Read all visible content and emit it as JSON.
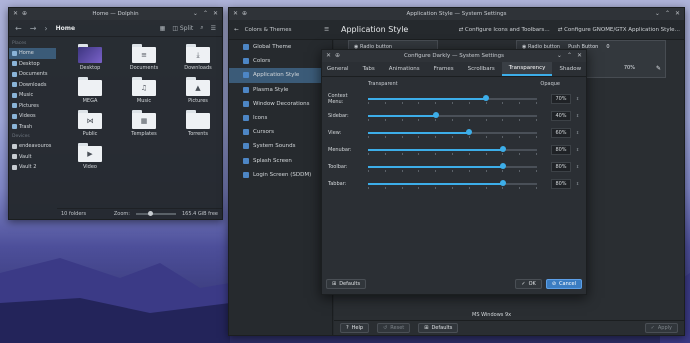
{
  "dolphin": {
    "title": "Home — Dolphin",
    "breadcrumb": "Home",
    "split_label": "Split",
    "places_header": "Places",
    "places": [
      "Home",
      "Desktop",
      "Documents",
      "Downloads",
      "Music",
      "Pictures",
      "Videos",
      "Trash"
    ],
    "devices_header": "Devices",
    "devices": [
      "endeavouros",
      "Vault",
      "Vault 2"
    ],
    "folders": [
      {
        "name": "Desktop",
        "glyph": ""
      },
      {
        "name": "Documents",
        "glyph": "≡"
      },
      {
        "name": "Downloads",
        "glyph": "⤓"
      },
      {
        "name": "MEGA",
        "glyph": ""
      },
      {
        "name": "Music",
        "glyph": "♫"
      },
      {
        "name": "Pictures",
        "glyph": "▲"
      },
      {
        "name": "Public",
        "glyph": "⋈"
      },
      {
        "name": "Templates",
        "glyph": "▦"
      },
      {
        "name": "Torrents",
        "glyph": ""
      },
      {
        "name": "Video",
        "glyph": "▶"
      }
    ],
    "status_count": "10 folders",
    "zoom_label": "Zoom:",
    "free_space": "165.4 GiB free"
  },
  "settings": {
    "title": "Application Style — System Settings",
    "back_label": "Colors & Themes",
    "page_title": "Application Style",
    "header_actions": [
      "Configure Icons and Toolbars…",
      "Configure GNOME/GTX Application Style…"
    ],
    "sidebar": [
      "Global Theme",
      "Colors",
      "Application Style",
      "Plasma Style",
      "Window Decorations",
      "Icons",
      "Cursors",
      "System Sounds",
      "Splash Screen",
      "Login Screen (SDDM)"
    ],
    "selected_index": 2,
    "preview_radio": "Radio button",
    "preview_push": "Push Button",
    "preview_value": "0",
    "preview_pct": "70%",
    "style_name": "MS Windows 9x",
    "footer": {
      "help": "Help",
      "reset": "Reset",
      "defaults": "Defaults",
      "apply": "Apply"
    }
  },
  "dialog": {
    "title": "Configure Darkly — System Settings",
    "tabs": [
      "General",
      "Tabs",
      "Animations",
      "Frames",
      "Scrollbars",
      "Transparency",
      "Shadow"
    ],
    "active_tab": 5,
    "scale_left": "Transparent",
    "scale_right": "Opaque",
    "sliders": [
      {
        "label": "Context Menu:",
        "value": 70,
        "display": "70%"
      },
      {
        "label": "Sidebar:",
        "value": 40,
        "display": "40%"
      },
      {
        "label": "View:",
        "value": 60,
        "display": "60%"
      },
      {
        "label": "Menubar:",
        "value": 80,
        "display": "80%"
      },
      {
        "label": "Toolbar:",
        "value": 80,
        "display": "80%"
      },
      {
        "label": "Tabbar:",
        "value": 80,
        "display": "80%"
      }
    ],
    "defaults_label": "Defaults",
    "ok_label": "OK",
    "cancel_label": "Cancel"
  }
}
